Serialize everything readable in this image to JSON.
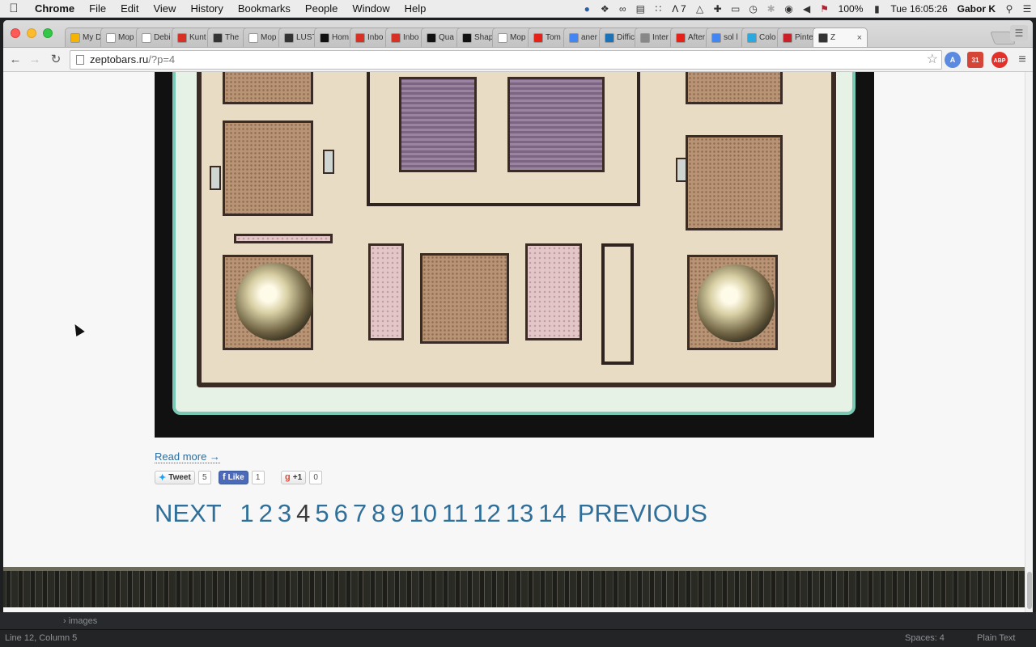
{
  "menubar": {
    "app_name": "Chrome",
    "items": [
      "File",
      "Edit",
      "View",
      "History",
      "Bookmarks",
      "People",
      "Window",
      "Help"
    ],
    "battery": "100%",
    "clock": "Tue 16:05:26",
    "user": "Gabor K",
    "notification_count": "7"
  },
  "tabs": [
    {
      "label": "My D",
      "icon": "drive-icon",
      "color": "#f4b400"
    },
    {
      "label": "Mop",
      "icon": "page-icon",
      "color": "#ffffff"
    },
    {
      "label": "Debi",
      "icon": "page-icon",
      "color": "#ffffff"
    },
    {
      "label": "Kunt",
      "icon": "gmail-icon",
      "color": "#d93025"
    },
    {
      "label": "The",
      "icon": "page-icon",
      "color": "#333333"
    },
    {
      "label": "Mop",
      "icon": "page-icon",
      "color": "#ffffff"
    },
    {
      "label": "LUST",
      "icon": "page-icon",
      "color": "#333333"
    },
    {
      "label": "Hom",
      "icon": "medium-icon",
      "color": "#111111"
    },
    {
      "label": "Inbo",
      "icon": "gmail-icon",
      "color": "#d93025"
    },
    {
      "label": "Inbo",
      "icon": "gmail-icon",
      "color": "#d93025"
    },
    {
      "label": "Qua",
      "icon": "q-icon",
      "color": "#111111"
    },
    {
      "label": "Shap",
      "icon": "q-icon",
      "color": "#111111"
    },
    {
      "label": "Mop",
      "icon": "page-icon",
      "color": "#ffffff"
    },
    {
      "label": "Tom",
      "icon": "youtube-icon",
      "color": "#e62117"
    },
    {
      "label": "aner",
      "icon": "google-icon",
      "color": "#4285f4"
    },
    {
      "label": "Diffic",
      "icon": "hb-icon",
      "color": "#1a73b8"
    },
    {
      "label": "Inter",
      "icon": "page-icon",
      "color": "#888888"
    },
    {
      "label": "After",
      "icon": "youtube-icon",
      "color": "#e62117"
    },
    {
      "label": "sol l",
      "icon": "google-icon",
      "color": "#4285f4"
    },
    {
      "label": "Colo",
      "icon": "page-icon",
      "color": "#2aa8e0"
    },
    {
      "label": "Pinte",
      "icon": "pinterest-icon",
      "color": "#cb2027"
    },
    {
      "label": "Z",
      "icon": "zepto-icon",
      "color": "#333333",
      "active": true
    }
  ],
  "toolbar": {
    "url_host": "zeptobars.ru",
    "url_path": "/?p=4",
    "gmail_badge": "31",
    "abp_label": "ABP"
  },
  "post": {
    "read_more": "Read more →"
  },
  "social": {
    "tweet_label": "Tweet",
    "tweet_count": "5",
    "like_label": "Like",
    "like_count": "1",
    "plusone_label": "+1",
    "plusone_count": "0"
  },
  "pagination": {
    "next_label": "NEXT",
    "pages": [
      "1",
      "2",
      "3",
      "4",
      "5",
      "6",
      "7",
      "8",
      "9",
      "10",
      "11",
      "12",
      "13",
      "14"
    ],
    "current": "4",
    "previous_label": "PREVIOUS"
  },
  "editor": {
    "folder": "images",
    "status_position": "Line 12, Column 5",
    "indentation": "Spaces: 4",
    "syntax": "Plain Text"
  }
}
